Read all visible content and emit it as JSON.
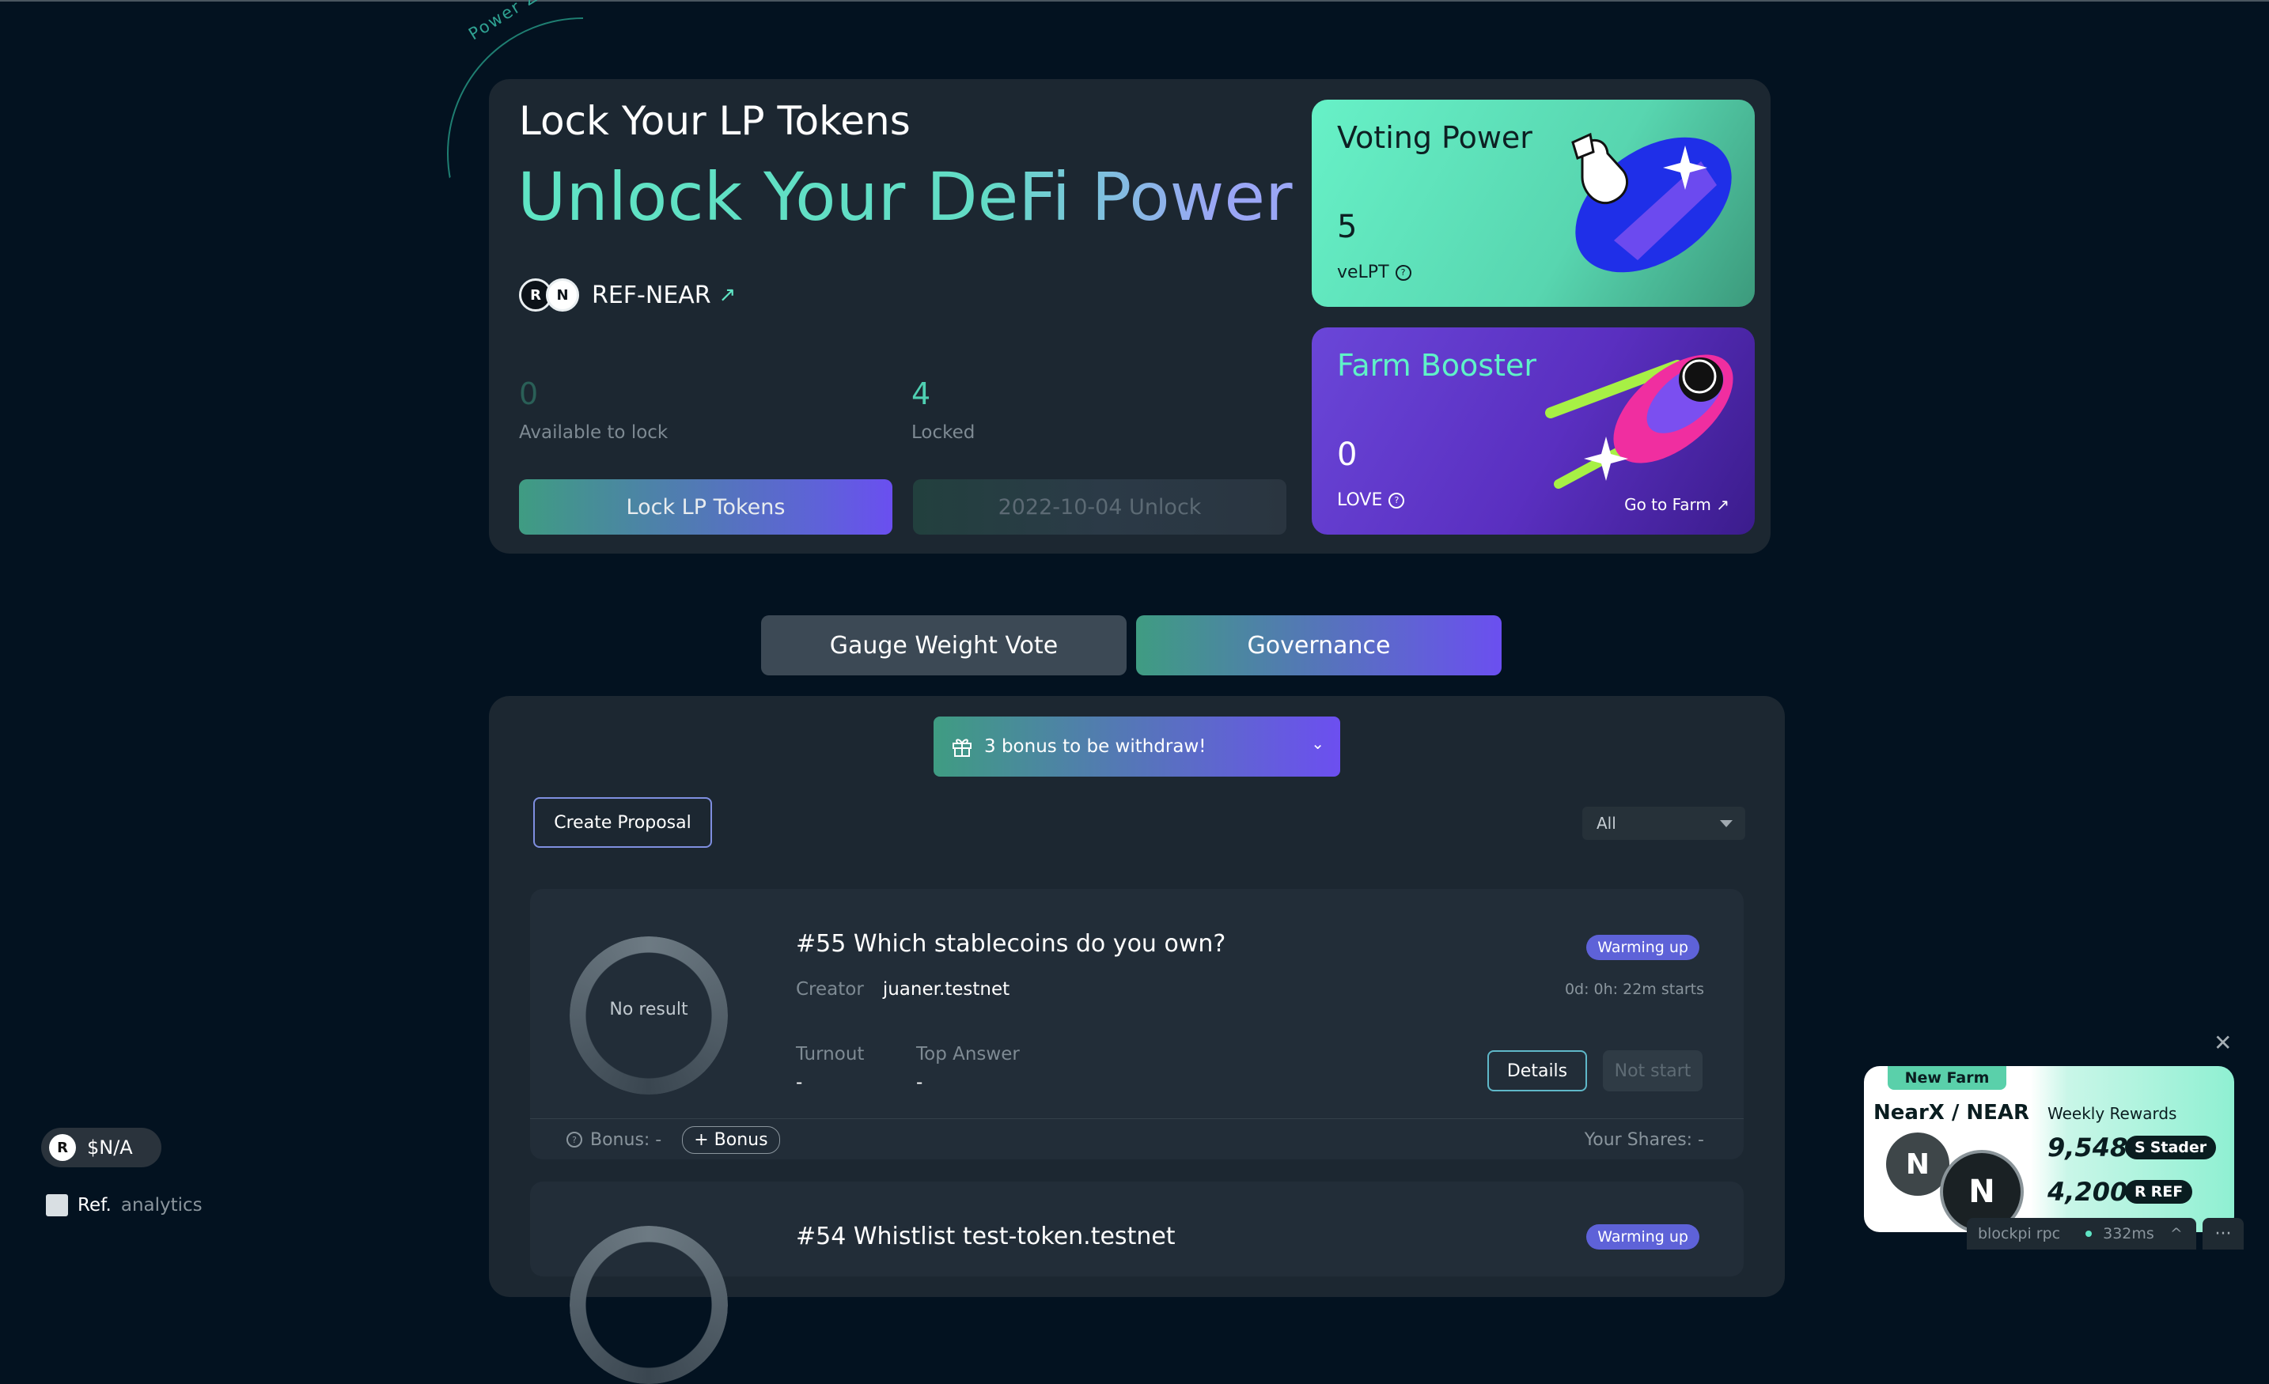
{
  "hero": {
    "badge_text": "Power Zone",
    "title": "Lock Your LP Tokens",
    "subtitle": "Unlock Your DeFi Power",
    "pair_name": "REF-NEAR",
    "pair_arrow": "↗",
    "available_value": "0",
    "available_label": "Available to lock",
    "locked_value": "4",
    "locked_label": "Locked",
    "lock_button": "Lock LP Tokens",
    "unlock_button": "2022-10-04 Unlock"
  },
  "voting_power": {
    "title": "Voting Power",
    "value": "5",
    "unit": "veLPT"
  },
  "farm_booster": {
    "title": "Farm Booster",
    "value": "0",
    "unit": "LOVE",
    "link": "Go to Farm ↗"
  },
  "tabs": [
    {
      "label": "Gauge Weight Vote",
      "active": false
    },
    {
      "label": "Governance",
      "active": true
    }
  ],
  "governance": {
    "bonus_bar": "3 bonus to be withdraw!",
    "create_button": "Create Proposal",
    "filter_value": "All",
    "proposals": [
      {
        "title": "#55 Which stablecoins do you own?",
        "status": "Warming up",
        "creator_label": "Creator",
        "creator": "juaner.testnet",
        "countdown": "0d: 0h: 22m starts",
        "result": "No result",
        "turnout_label": "Turnout",
        "turnout": "-",
        "top_answer_label": "Top Answer",
        "top_answer": "-",
        "details_button": "Details",
        "action_button": "Not start",
        "bonus_label": "Bonus: -",
        "add_bonus": "+ Bonus",
        "shares_label": "Your Shares:  -"
      },
      {
        "title": "#54 Whistlist test-token.testnet",
        "status": "Warming up"
      }
    ]
  },
  "footer": {
    "price": "$N/A",
    "analytics_brand": "Ref.",
    "analytics_word": "analytics"
  },
  "promo": {
    "tag": "New Farm",
    "pair": "NearX / NEAR",
    "rewards_label": "Weekly Rewards",
    "reward1_amount": "9,548",
    "reward1_token": "Stader",
    "reward2_amount": "4,200",
    "reward2_token": "REF"
  },
  "rpc": {
    "name": "blockpi rpc",
    "latency": "332ms"
  },
  "colors": {
    "background": "#031220",
    "card": "#1c2731",
    "accent_green": "#5fe4c4",
    "accent_purple": "#6c4ff0",
    "status_badge": "#5e62d8"
  }
}
